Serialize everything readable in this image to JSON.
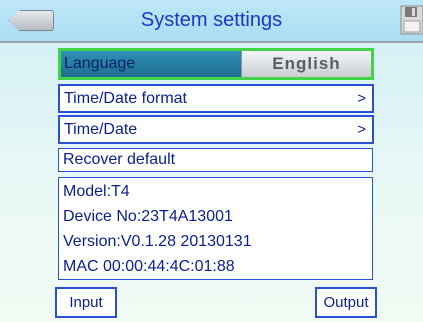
{
  "header": {
    "title": "System settings",
    "back_icon": "back-arrow-icon",
    "save_icon": "floppy-save-icon"
  },
  "settings": {
    "language_label": "Language",
    "language_value": "English",
    "time_format_label": "Time/Date format",
    "time_date_label": "Time/Date",
    "chevron": ">",
    "recover_label": "Recover default"
  },
  "device_info": {
    "model": "Model:T4",
    "device_no": "Device No:23T4A13001",
    "version": "Version:V0.1.28 20130131",
    "mac": "MAC 00:00:44:4C:01:88"
  },
  "footer": {
    "input_label": "Input",
    "output_label": "Output"
  },
  "colors": {
    "text": "#0a1f8f",
    "border": "#2b50d8",
    "selection": "#41d449",
    "title": "#1d36c9"
  }
}
